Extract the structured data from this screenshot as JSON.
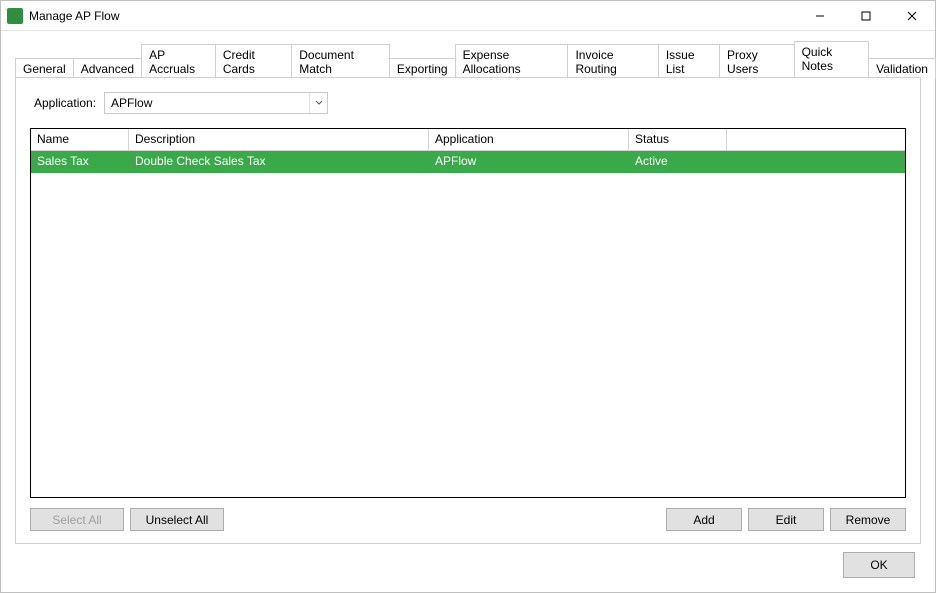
{
  "window": {
    "title": "Manage AP Flow"
  },
  "tabs": [
    {
      "label": "General"
    },
    {
      "label": "Advanced"
    },
    {
      "label": "AP Accruals"
    },
    {
      "label": "Credit Cards"
    },
    {
      "label": "Document Match"
    },
    {
      "label": "Exporting"
    },
    {
      "label": "Expense Allocations"
    },
    {
      "label": "Invoice Routing"
    },
    {
      "label": "Issue List"
    },
    {
      "label": "Proxy Users"
    },
    {
      "label": "Quick Notes",
      "active": true
    },
    {
      "label": "Validation"
    }
  ],
  "application_picker": {
    "label": "Application:",
    "value": "APFlow"
  },
  "grid": {
    "columns": {
      "name": "Name",
      "description": "Description",
      "application": "Application",
      "status": "Status"
    },
    "rows": [
      {
        "name": "Sales Tax",
        "description": "Double Check Sales Tax",
        "application": "APFlow",
        "status": "Active",
        "selected": true
      }
    ]
  },
  "buttons": {
    "select_all": "Select All",
    "unselect_all": "Unselect All",
    "add": "Add",
    "edit": "Edit",
    "remove": "Remove",
    "ok": "OK"
  }
}
